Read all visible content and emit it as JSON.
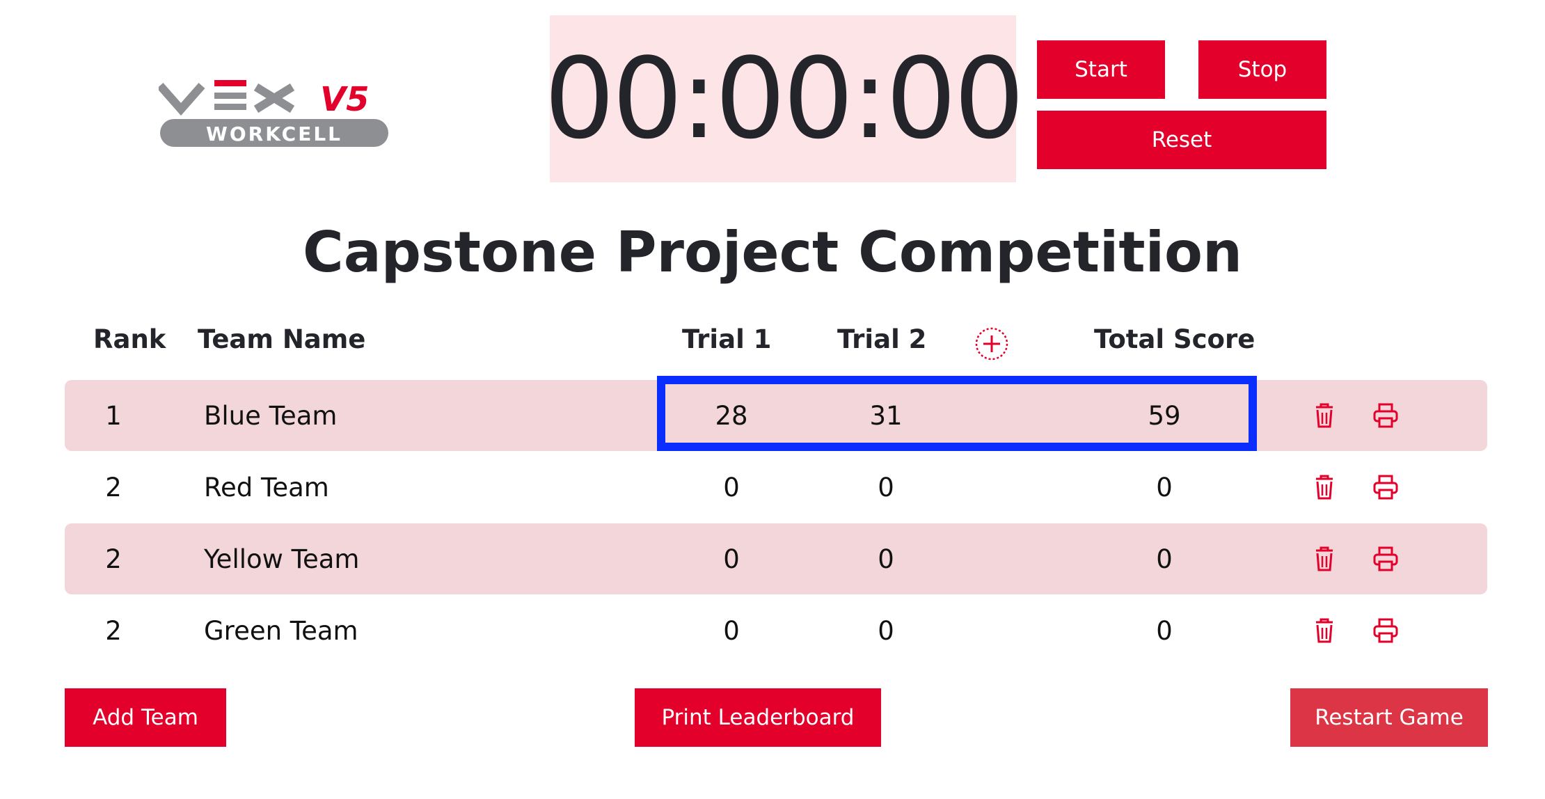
{
  "logo": {
    "brand": "VEX",
    "model": "V5",
    "sub": "WORKCELL"
  },
  "timer": {
    "display": "00:00:00",
    "start_label": "Start",
    "stop_label": "Stop",
    "reset_label": "Reset"
  },
  "title": "Capstone Project Competition",
  "table": {
    "headers": {
      "rank": "Rank",
      "team": "Team Name",
      "trial1": "Trial 1",
      "trial2": "Trial 2",
      "total": "Total Score"
    },
    "rows": [
      {
        "rank": "1",
        "team": "Blue Team",
        "trial1": "28",
        "trial2": "31",
        "total": "59"
      },
      {
        "rank": "2",
        "team": "Red Team",
        "trial1": "0",
        "trial2": "0",
        "total": "0"
      },
      {
        "rank": "2",
        "team": "Yellow Team",
        "trial1": "0",
        "trial2": "0",
        "total": "0"
      },
      {
        "rank": "2",
        "team": "Green Team",
        "trial1": "0",
        "trial2": "0",
        "total": "0"
      }
    ]
  },
  "footer": {
    "add_team_label": "Add Team",
    "print_leaderboard_label": "Print Leaderboard",
    "restart_label": "Restart Game"
  },
  "icons": {
    "add_trial": "plus-circle-icon",
    "delete": "trash-icon",
    "print": "printer-icon"
  },
  "colors": {
    "accent": "#e3002b",
    "restart": "#dc3545",
    "timer_bg": "#fde4e6",
    "row_shade": "#f2d6da",
    "highlight": "#0a2eff"
  }
}
